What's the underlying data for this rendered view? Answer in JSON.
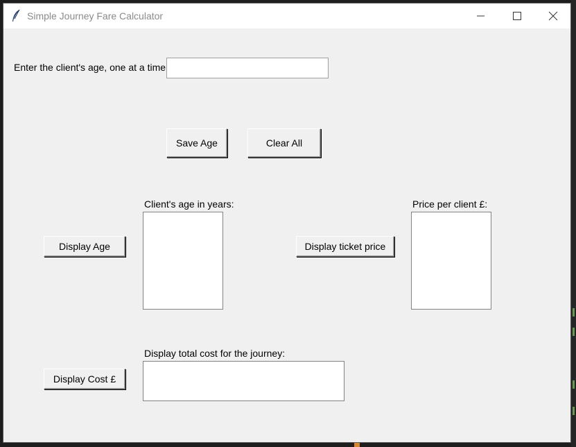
{
  "window": {
    "title": "Simple Journey Fare Calculator"
  },
  "form": {
    "age_label": "Enter the client's age, one at a time",
    "age_value": ""
  },
  "buttons": {
    "save_age": "Save Age",
    "clear_all": "Clear All",
    "display_age": "Display Age",
    "display_ticket_price": "Display ticket price",
    "display_cost": "Display  Cost £"
  },
  "lists": {
    "ages_label": "Client's age in years:",
    "ages": [],
    "prices_label": "Price per client £:",
    "prices": []
  },
  "total": {
    "label": "Display total cost for the journey:",
    "value": ""
  }
}
